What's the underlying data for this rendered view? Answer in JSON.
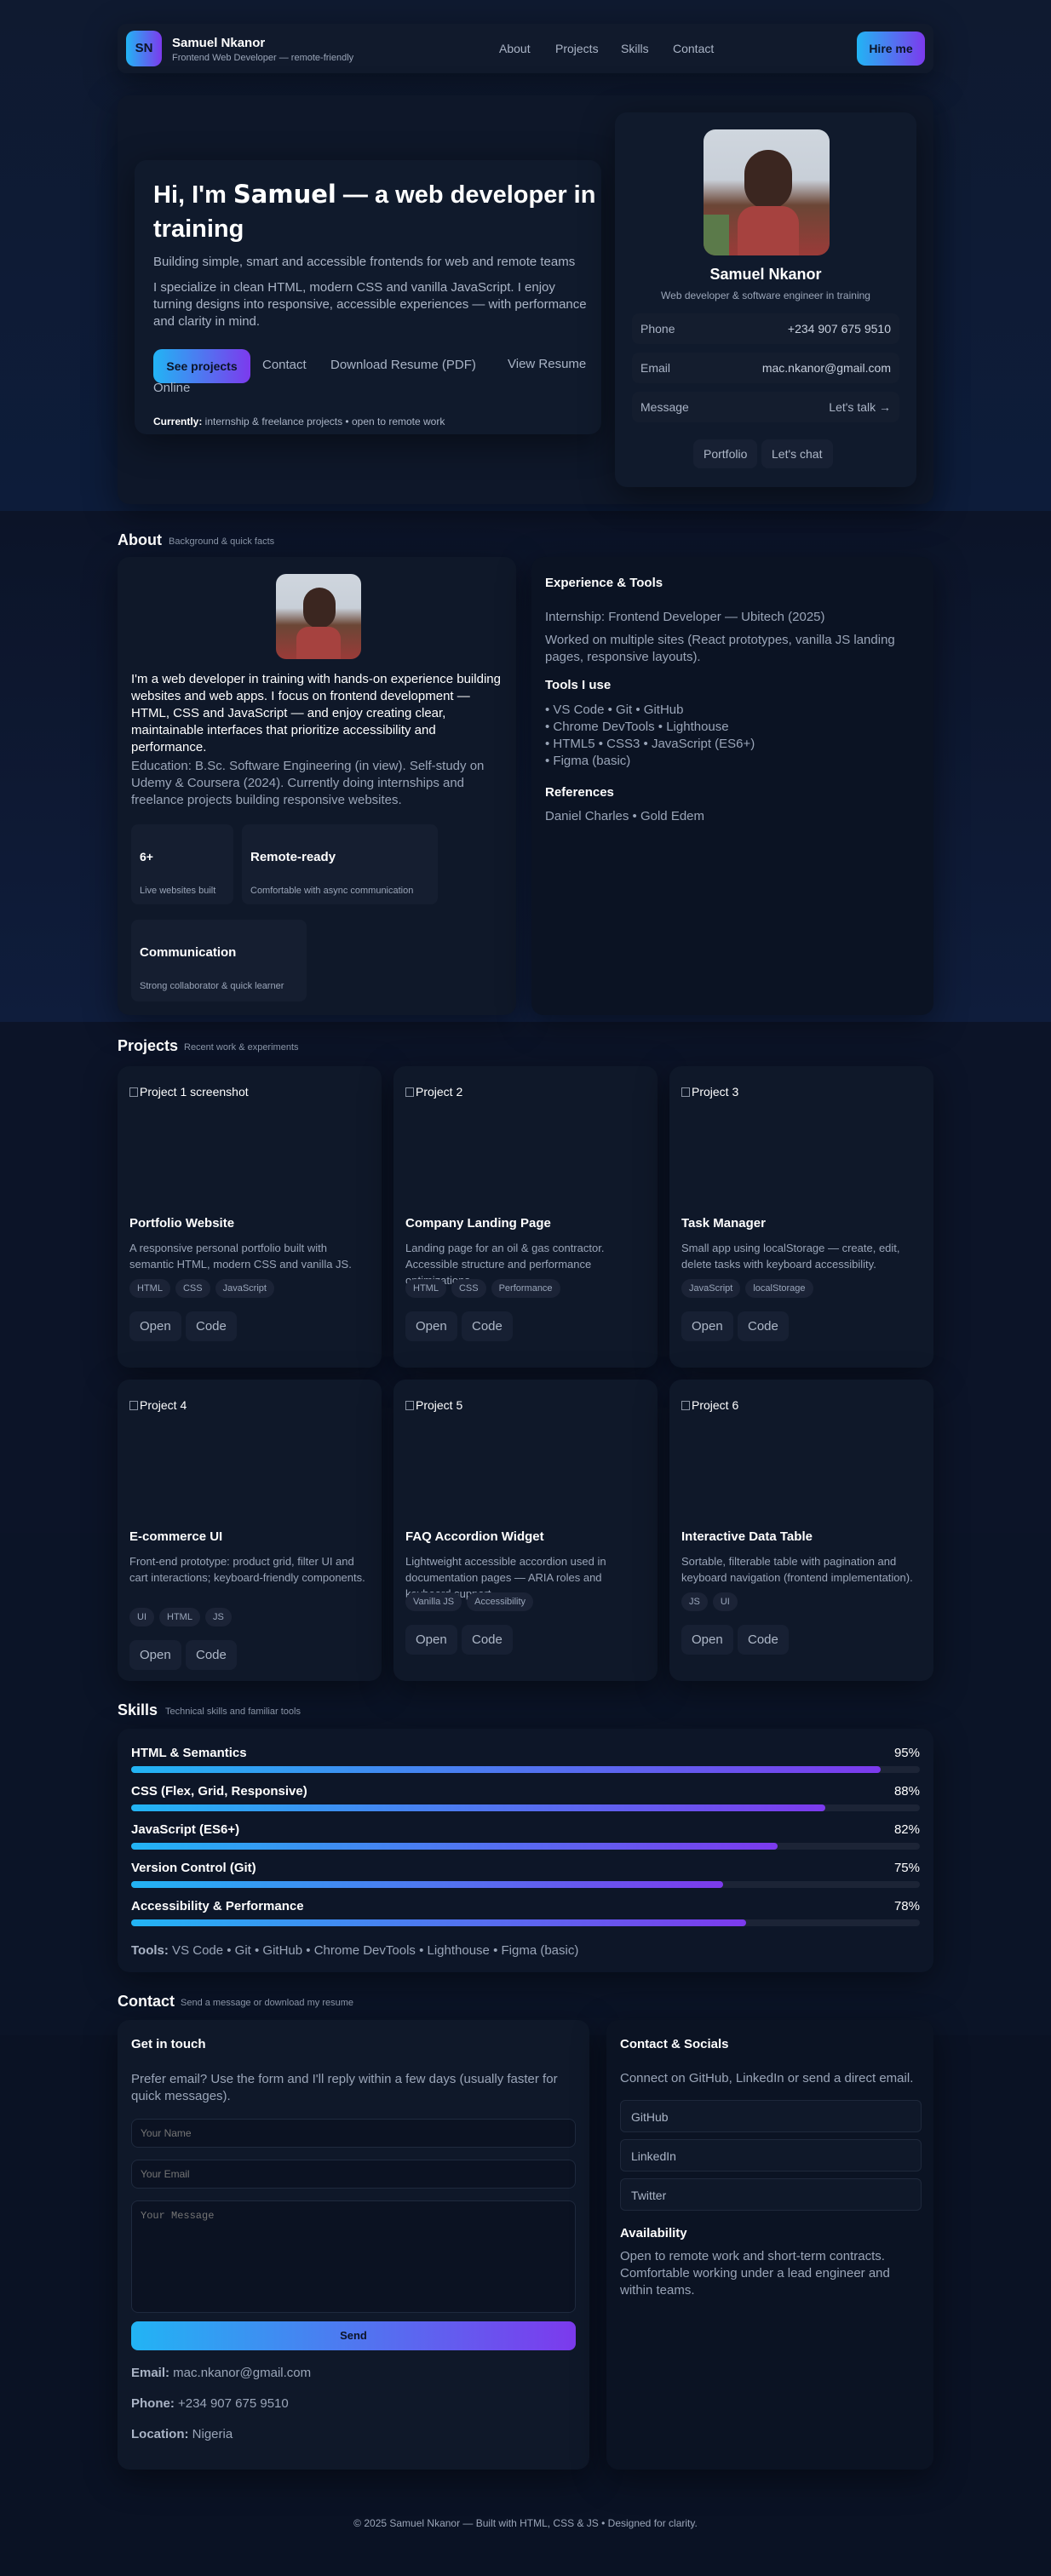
{
  "brand": {
    "initials": "SN",
    "name": "Samuel Nkanor",
    "tagline": "Frontend Web Developer — remote-friendly"
  },
  "nav": {
    "items": [
      "About",
      "Projects",
      "Skills",
      "Contact"
    ],
    "cta": "Hire me"
  },
  "hero": {
    "heading_pre": "Hi, I'm ",
    "heading_name": "Samuel",
    "heading_post": " — a web developer in training",
    "lead": "Building simple, smart and accessible frontends for web and remote teams",
    "body": "I specialize in clean HTML, modern CSS and vanilla JavaScript. I enjoy turning designs into responsive, accessible experiences — with performance and clarity in mind.",
    "btn_primary": "See projects",
    "btn_contact": "Contact",
    "btn_resume": "Download Resume (PDF)",
    "btn_view": "View Resume Online",
    "currently_label": "Currently:",
    "currently_text": " internship & freelance projects • open to remote work"
  },
  "profile": {
    "name": "Samuel Nkanor",
    "role": "Web developer & software engineer in training",
    "phone_label": "Phone",
    "phone": "+234 907 675 9510",
    "email_label": "Email",
    "email": "mac.nkanor@gmail.com",
    "message_label": "Message",
    "message": "Let's talk →",
    "btn_portfolio": "Portfolio",
    "btn_chat": "Let's chat"
  },
  "about": {
    "title": "About",
    "subtitle": "Background & quick facts",
    "intro": "I'm a web developer in training with hands-on experience building websites and web apps. I focus on frontend development — HTML, CSS and JavaScript — and enjoy creating clear, maintainable interfaces that prioritize accessibility and performance.",
    "education": "Education: B.Sc. Software Engineering (in view). Self-study on Udemy & Coursera (2024). Currently doing internships and freelance projects building responsive websites.",
    "facts": [
      {
        "title": "6+",
        "desc": "Live websites built"
      },
      {
        "title": "Remote-ready",
        "desc": "Comfortable with async communication"
      },
      {
        "title": "Communication",
        "desc": "Strong collaborator & quick learner"
      }
    ],
    "exp_title": "Experience & Tools",
    "exp_line1": "Internship: Frontend Developer — Ubitech (2025)",
    "exp_line2": "Worked on multiple sites (React prototypes, vanilla JS landing pages, responsive layouts).",
    "tools_title": "Tools I use",
    "tools": [
      "VS Code • Git • GitHub",
      "Chrome DevTools • Lighthouse",
      "HTML5 • CSS3 • JavaScript (ES6+)",
      "Figma (basic)"
    ],
    "refs_title": "References",
    "refs": "Daniel Charles • Gold Edem"
  },
  "projects": {
    "title": "Projects",
    "subtitle": "Recent work & experiments",
    "open_label": "Open",
    "code_label": "Code",
    "items": [
      {
        "img_alt": "Project 1 screenshot",
        "title": "Portfolio Website",
        "desc": "A responsive personal portfolio built with semantic HTML, modern CSS and vanilla JS.",
        "tags": [
          "HTML",
          "CSS",
          "JavaScript"
        ]
      },
      {
        "img_alt": "Project 2",
        "title": "Company Landing Page",
        "desc": "Landing page for an oil & gas contractor. Accessible structure and performance optimizations.",
        "tags": [
          "HTML",
          "CSS",
          "Performance"
        ]
      },
      {
        "img_alt": "Project 3",
        "title": "Task Manager",
        "desc": "Small app using localStorage — create, edit, delete tasks with keyboard accessibility.",
        "tags": [
          "JavaScript",
          "localStorage"
        ]
      },
      {
        "img_alt": "Project 4",
        "title": "E-commerce UI",
        "desc": "Front-end prototype: product grid, filter UI and cart interactions; keyboard-friendly components.",
        "tags": [
          "UI",
          "HTML",
          "JS"
        ]
      },
      {
        "img_alt": "Project 5",
        "title": "FAQ Accordion Widget",
        "desc": "Lightweight accessible accordion used in documentation pages — ARIA roles and keyboard support.",
        "tags": [
          "Vanilla JS",
          "Accessibility"
        ]
      },
      {
        "img_alt": "Project 6",
        "title": "Interactive Data Table",
        "desc": "Sortable, filterable table with pagination and keyboard navigation (frontend implementation).",
        "tags": [
          "JS",
          "UI"
        ]
      }
    ]
  },
  "skills": {
    "title": "Skills",
    "subtitle": "Technical skills and familiar tools",
    "items": [
      {
        "name": "HTML & Semantics",
        "pct": "95%",
        "value": 95
      },
      {
        "name": "CSS (Flex, Grid, Responsive)",
        "pct": "88%",
        "value": 88
      },
      {
        "name": "JavaScript (ES6+)",
        "pct": "82%",
        "value": 82
      },
      {
        "name": "Version Control (Git)",
        "pct": "75%",
        "value": 75
      },
      {
        "name": "Accessibility & Performance",
        "pct": "78%",
        "value": 78
      }
    ],
    "tools_label": "Tools:",
    "tools_text": " VS Code • Git • GitHub • Chrome DevTools • Lighthouse • Figma (basic)"
  },
  "contact": {
    "title": "Contact",
    "subtitle": "Send a message or download my resume",
    "form_title": "Get in touch",
    "form_intro": "Prefer email? Use the form and I'll reply within a few days (usually faster for quick messages).",
    "name_ph": "Your Name",
    "email_ph": "Your Email",
    "message_ph": "Your Message",
    "send": "Send",
    "email_label": "Email:",
    "email": " mac.nkanor@gmail.com",
    "phone_label": "Phone:",
    "phone": " +234 907 675 9510",
    "location_label": "Location:",
    "location": " Nigeria",
    "socials_title": "Contact & Socials",
    "socials_intro": "Connect on GitHub, LinkedIn or send a direct email.",
    "links": [
      "GitHub",
      "LinkedIn",
      "Twitter"
    ],
    "avail_title": "Availability",
    "avail_text": "Open to remote work and short-term contracts. Comfortable working under a lead engineer and within teams."
  },
  "footer": {
    "text": "© 2025 Samuel Nkanor — Built with HTML, CSS & JS • Designed for clarity."
  }
}
